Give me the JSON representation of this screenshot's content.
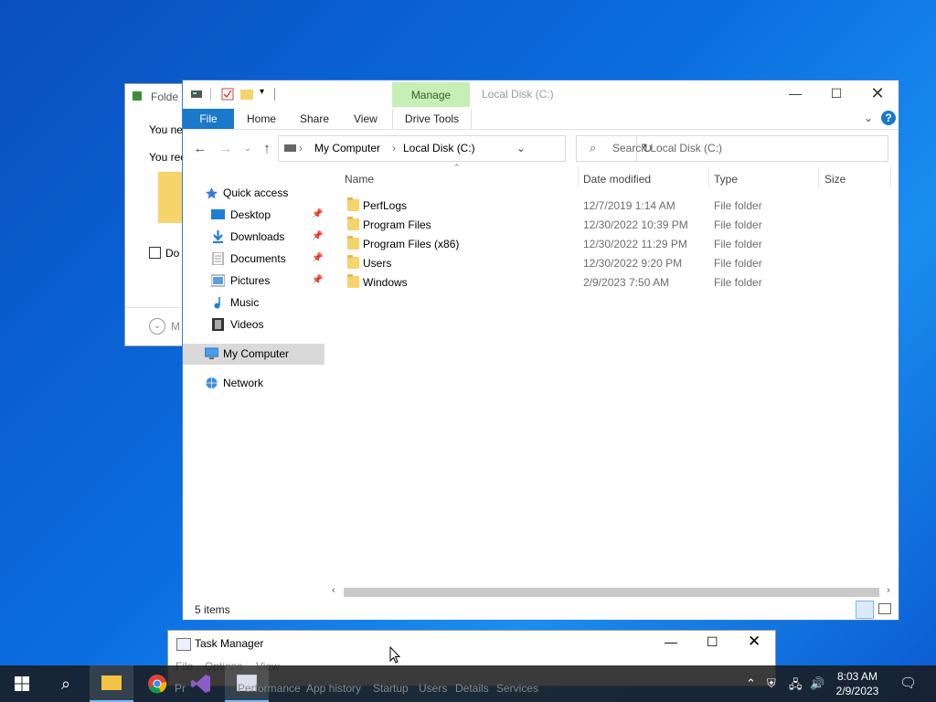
{
  "background_dialog": {
    "title": "Folde",
    "line1": "You ne",
    "line2": "You rec",
    "checkbox_label": "Do",
    "more_label": "M"
  },
  "explorer": {
    "title": "Local Disk (C:)",
    "ribbon": {
      "tabs": [
        "File",
        "Home",
        "Share",
        "View"
      ],
      "contextual_group": "Manage",
      "contextual_tab": "Drive Tools"
    },
    "address": {
      "segments": [
        "My Computer",
        "Local Disk (C:)"
      ]
    },
    "search_placeholder": "Search Local Disk (C:)",
    "nav_pane": {
      "quick_access": "Quick access",
      "items": [
        {
          "label": "Desktop",
          "icon": "desktop-icon",
          "pinned": true
        },
        {
          "label": "Downloads",
          "icon": "downloads-icon",
          "pinned": true
        },
        {
          "label": "Documents",
          "icon": "documents-icon",
          "pinned": true
        },
        {
          "label": "Pictures",
          "icon": "pictures-icon",
          "pinned": true
        },
        {
          "label": "Music",
          "icon": "music-icon",
          "pinned": false
        },
        {
          "label": "Videos",
          "icon": "videos-icon",
          "pinned": false
        }
      ],
      "my_computer": "My Computer",
      "network": "Network"
    },
    "columns": [
      "Name",
      "Date modified",
      "Type",
      "Size"
    ],
    "files": [
      {
        "name": "PerfLogs",
        "date": "12/7/2019 1:14 AM",
        "type": "File folder"
      },
      {
        "name": "Program Files",
        "date": "12/30/2022 10:39 PM",
        "type": "File folder"
      },
      {
        "name": "Program Files (x86)",
        "date": "12/30/2022 11:29 PM",
        "type": "File folder"
      },
      {
        "name": "Users",
        "date": "12/30/2022 9:20 PM",
        "type": "File folder"
      },
      {
        "name": "Windows",
        "date": "2/9/2023 7:50 AM",
        "type": "File folder"
      }
    ],
    "status": "5 items"
  },
  "task_manager": {
    "title": "Task Manager",
    "menu": [
      "File",
      "Options",
      "View"
    ],
    "tabs": [
      "Pr",
      "Performance",
      "App history",
      "Startup",
      "Users",
      "Details",
      "Services"
    ]
  },
  "taskbar": {
    "time": "8:03 AM",
    "date": "2/9/2023",
    "apps": [
      "file-explorer-icon",
      "chrome-icon",
      "visual-studio-icon",
      "task-manager-icon"
    ]
  },
  "colors": {
    "accent": "#1979ca",
    "manage": "#c6efb6",
    "selection": "#d9d9d9"
  }
}
